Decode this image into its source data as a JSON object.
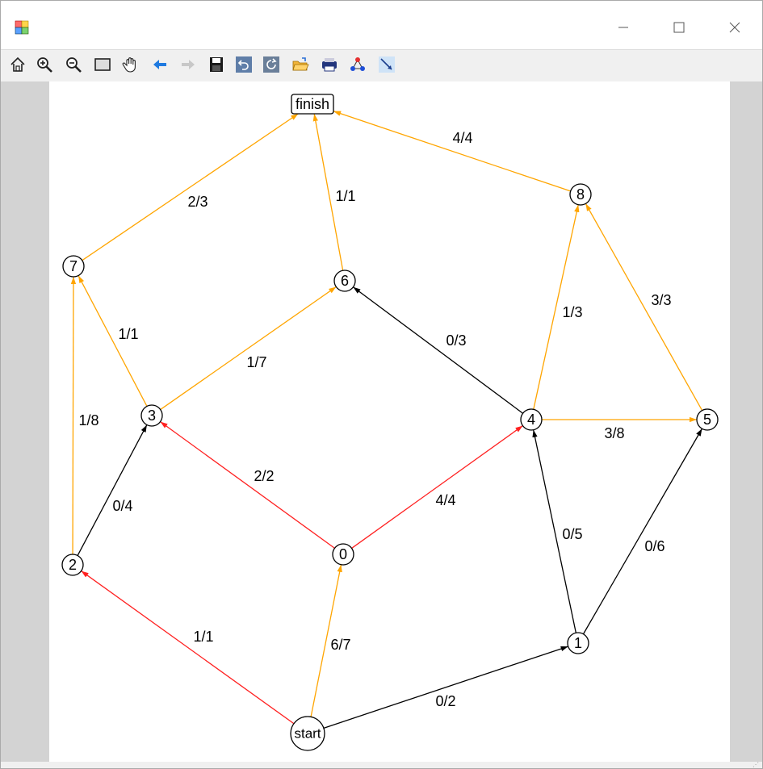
{
  "window": {
    "title": ""
  },
  "toolbar": {
    "items": [
      {
        "icon": "home-icon"
      },
      {
        "icon": "zoom-in-icon"
      },
      {
        "icon": "zoom-out-icon"
      },
      {
        "icon": "window-zoom-icon"
      },
      {
        "icon": "pan-hand-icon"
      },
      {
        "icon": "back-arrow-icon"
      },
      {
        "icon": "forward-arrow-icon"
      },
      {
        "icon": "save-icon"
      },
      {
        "icon": "undo-icon"
      },
      {
        "icon": "redo-icon"
      },
      {
        "icon": "open-folder-icon"
      },
      {
        "icon": "print-icon"
      },
      {
        "icon": "layout-icon"
      },
      {
        "icon": "edge-insert-icon"
      }
    ]
  },
  "graph": {
    "colors": {
      "red": "#ff2020",
      "orange": "#ffa500",
      "black": "#000000"
    },
    "nodes": [
      {
        "id": "finish",
        "label": "finish",
        "shape": "box"
      },
      {
        "id": "8",
        "label": "8",
        "shape": "circle"
      },
      {
        "id": "7",
        "label": "7",
        "shape": "circle"
      },
      {
        "id": "6",
        "label": "6",
        "shape": "circle"
      },
      {
        "id": "3",
        "label": "3",
        "shape": "circle"
      },
      {
        "id": "4",
        "label": "4",
        "shape": "circle"
      },
      {
        "id": "5",
        "label": "5",
        "shape": "circle"
      },
      {
        "id": "2",
        "label": "2",
        "shape": "circle"
      },
      {
        "id": "0",
        "label": "0",
        "shape": "circle"
      },
      {
        "id": "1",
        "label": "1",
        "shape": "circle"
      },
      {
        "id": "start",
        "label": "start",
        "shape": "circle"
      }
    ],
    "edges": [
      {
        "from": "start",
        "to": "2",
        "label": "1/1",
        "color": "red"
      },
      {
        "from": "start",
        "to": "0",
        "label": "6/7",
        "color": "orange"
      },
      {
        "from": "start",
        "to": "1",
        "label": "0/2",
        "color": "black"
      },
      {
        "from": "0",
        "to": "3",
        "label": "2/2",
        "color": "red"
      },
      {
        "from": "0",
        "to": "4",
        "label": "4/4",
        "color": "red"
      },
      {
        "from": "2",
        "to": "3",
        "label": "0/4",
        "color": "black"
      },
      {
        "from": "2",
        "to": "7",
        "label": "1/8",
        "color": "orange"
      },
      {
        "from": "3",
        "to": "7",
        "label": "1/1",
        "color": "orange"
      },
      {
        "from": "3",
        "to": "6",
        "label": "1/7",
        "color": "orange"
      },
      {
        "from": "1",
        "to": "4",
        "label": "0/5",
        "color": "black"
      },
      {
        "from": "1",
        "to": "5",
        "label": "0/6",
        "color": "black"
      },
      {
        "from": "4",
        "to": "6",
        "label": "0/3",
        "color": "black"
      },
      {
        "from": "4",
        "to": "5",
        "label": "3/8",
        "color": "orange"
      },
      {
        "from": "4",
        "to": "8",
        "label": "1/3",
        "color": "orange"
      },
      {
        "from": "5",
        "to": "8",
        "label": "3/3",
        "color": "orange"
      },
      {
        "from": "7",
        "to": "finish",
        "label": "2/3",
        "color": "orange"
      },
      {
        "from": "6",
        "to": "finish",
        "label": "1/1",
        "color": "orange"
      },
      {
        "from": "8",
        "to": "finish",
        "label": "4/4",
        "color": "orange"
      }
    ]
  }
}
